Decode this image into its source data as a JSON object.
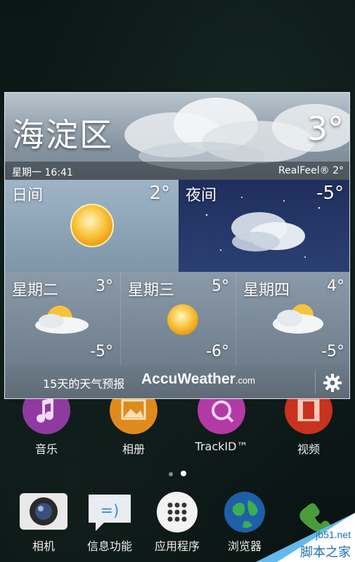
{
  "widget": {
    "city": "海淀区",
    "current_temp": "3°",
    "datetime": "星期一 16:41",
    "realfeel": "RealFeel® 2°",
    "day": {
      "label": "日间",
      "temp": "2°"
    },
    "night": {
      "label": "夜间",
      "temp": "-5°"
    },
    "forecast": [
      {
        "day": "星期二",
        "high": "3°",
        "low": "-5°",
        "icon": "partly-sunny-icon"
      },
      {
        "day": "星期三",
        "high": "5°",
        "low": "-6°",
        "icon": "sunny-icon"
      },
      {
        "day": "星期四",
        "high": "4°",
        "low": "-5°",
        "icon": "partly-sunny-icon"
      }
    ],
    "extended_link": "15天的天气预报",
    "brand": "AccuWeather",
    "brand_suffix": ".com",
    "settings_icon": "gear-icon"
  },
  "home_row1": [
    {
      "label": "音乐",
      "icon": "music-icon",
      "color": "#8e3aa0"
    },
    {
      "label": "相册",
      "icon": "album-icon",
      "color": "#e08a1e"
    },
    {
      "label": "TrackID™",
      "icon": "trackid-icon",
      "color": "#b23aa5"
    },
    {
      "label": "视频",
      "icon": "video-icon",
      "color": "#c8321e"
    }
  ],
  "dock": [
    {
      "label": "相机",
      "icon": "camera-icon"
    },
    {
      "label": "信息功能",
      "icon": "messaging-icon"
    },
    {
      "label": "应用程序",
      "icon": "apps-grid-icon"
    },
    {
      "label": "浏览器",
      "icon": "browser-icon"
    },
    {
      "label": "",
      "icon": "phone-icon"
    }
  ],
  "watermark": {
    "site": "jb51.net",
    "text": "脚本之家"
  }
}
